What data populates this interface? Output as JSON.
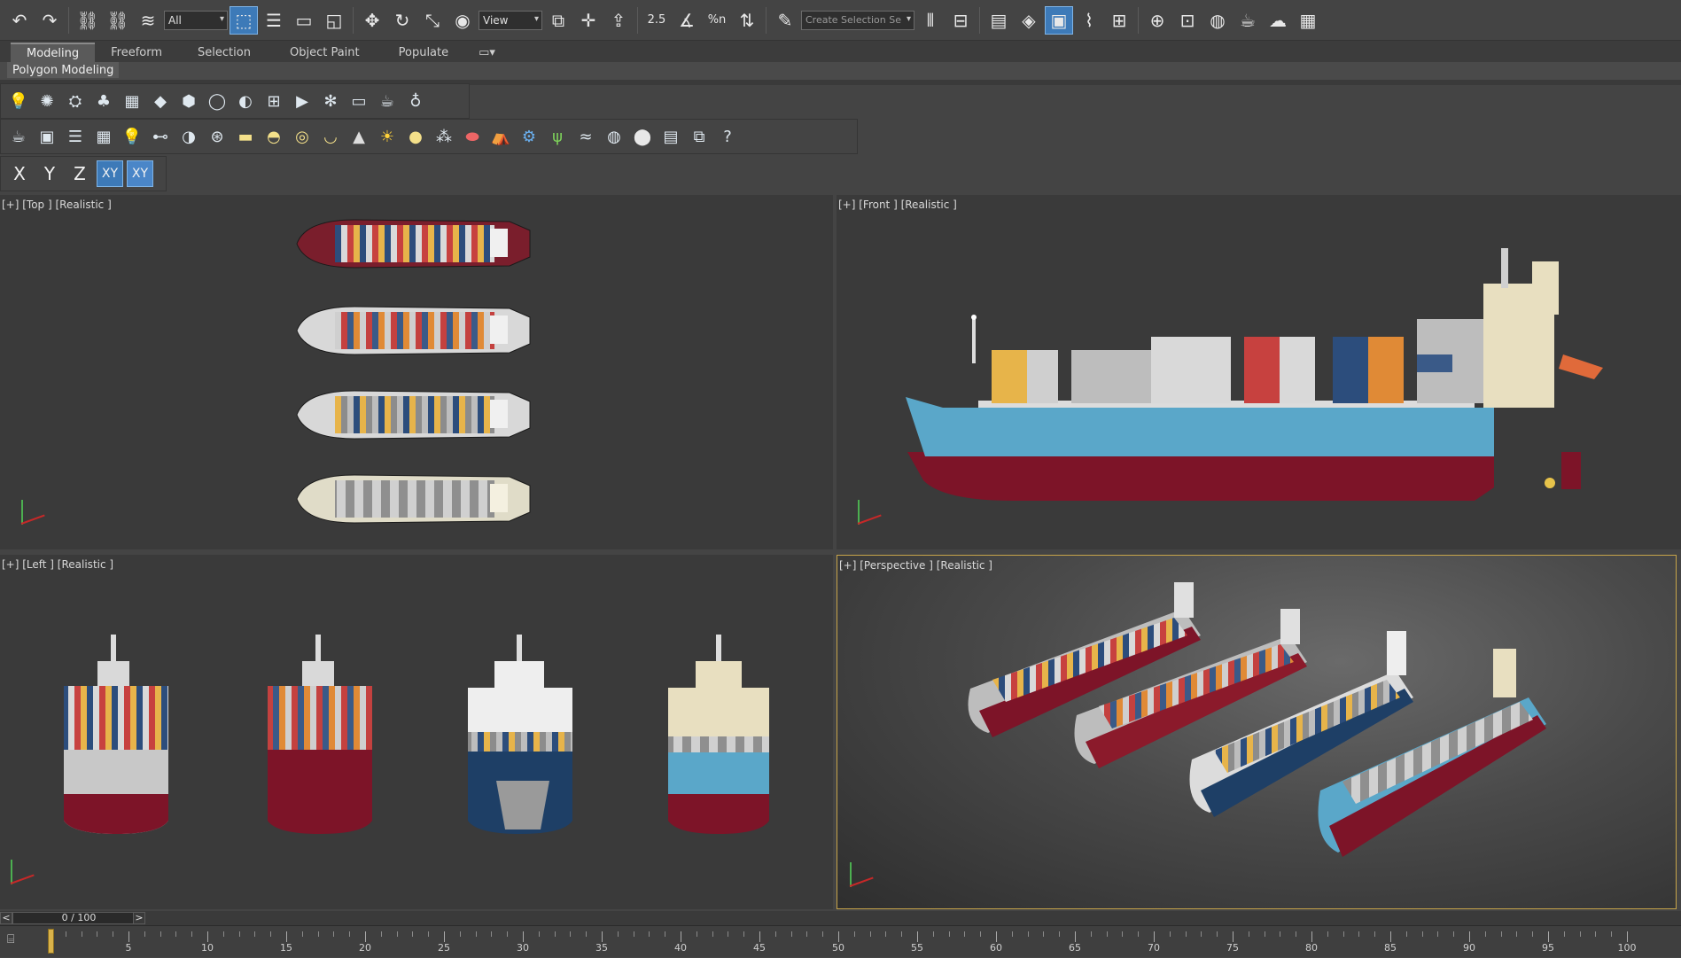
{
  "toolbar": {
    "selection_filter": "All",
    "reference_coord": "View",
    "named_selection_placeholder": "Create Selection Se",
    "snap_angle_label": "2.5",
    "percent_snap_label": "%n"
  },
  "ribbon": {
    "tabs": [
      {
        "label": "Modeling",
        "active": true
      },
      {
        "label": "Freeform",
        "active": false
      },
      {
        "label": "Selection",
        "active": false
      },
      {
        "label": "Object Paint",
        "active": false
      },
      {
        "label": "Populate",
        "active": false
      }
    ],
    "panel_label": "Polygon Modeling"
  },
  "axis_constraints": {
    "x": "X",
    "y": "Y",
    "z": "Z",
    "xy": "XY",
    "xy_snap": "XY"
  },
  "viewports": {
    "top": {
      "label": "[+] [Top ] [Realistic ]"
    },
    "front": {
      "label": "[+] [Front ] [Realistic ]"
    },
    "left": {
      "label": "[+] [Left ] [Realistic ]"
    },
    "perspective": {
      "label": "[+] [Perspective ] [Realistic ]"
    }
  },
  "timeline": {
    "slider_text": "0 / 100",
    "prev": "<",
    "next": ">",
    "ticks": [
      "5",
      "10",
      "15",
      "20",
      "25",
      "30",
      "35",
      "40",
      "45",
      "50",
      "55",
      "60",
      "65",
      "70",
      "75",
      "80",
      "85",
      "90",
      "95",
      "100"
    ]
  },
  "colors": {
    "accent_active": "#3d7ab8",
    "viewport_active_border": "#c7a44a",
    "hull_red": "#8b1a2b",
    "hull_blue": "#5aa7c9",
    "hull_navy": "#1e3f66"
  }
}
